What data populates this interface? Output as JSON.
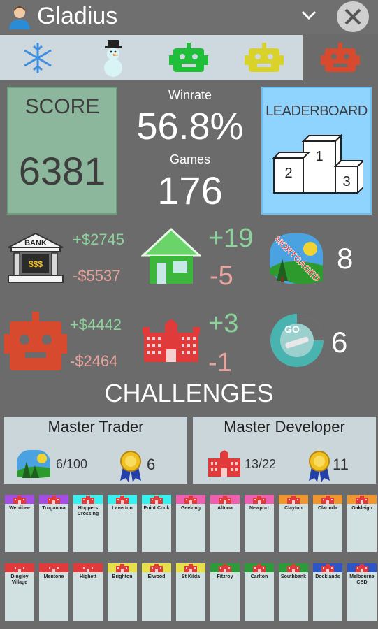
{
  "header": {
    "player_name": "Gladius"
  },
  "tabs": [
    {
      "icon": "snowflake-icon"
    },
    {
      "icon": "snowman-icon"
    },
    {
      "icon": "green-robot-icon"
    },
    {
      "icon": "yellow-robot-icon"
    },
    {
      "icon": "red-robot-icon",
      "active": true
    }
  ],
  "score": {
    "label": "SCORE",
    "value": "6381"
  },
  "winrate": {
    "label": "Winrate",
    "value": "56.8%"
  },
  "games": {
    "label": "Games",
    "value": "176"
  },
  "leaderboard": {
    "label": "LEADERBOARD",
    "places": [
      "1",
      "2",
      "3"
    ]
  },
  "bank": {
    "label": "BANK",
    "sign": "$$$",
    "plus": "+$2745",
    "minus": "-$5537"
  },
  "houses": {
    "plus": "+19",
    "minus": "-5"
  },
  "mortgaged": {
    "stamp": "MORTGAGED",
    "count": "8"
  },
  "robot": {
    "plus": "+$4442",
    "minus": "-$2464"
  },
  "hotels": {
    "plus": "+3",
    "minus": "-1"
  },
  "go": {
    "label": "GO",
    "count": "6"
  },
  "challenges_title": "CHALLENGES",
  "challenges": [
    {
      "title": "Master Trader",
      "progress": "6/100",
      "medals": "6"
    },
    {
      "title": "Master Developer",
      "progress": "13/22",
      "medals": "11"
    }
  ],
  "properties_row1": [
    {
      "name": "Werribee",
      "color": "#a44ee6"
    },
    {
      "name": "Truganina",
      "color": "#a44ee6"
    },
    {
      "name": "Hoppers Crossing",
      "color": "#37f0f0"
    },
    {
      "name": "Laverton",
      "color": "#37f0f0"
    },
    {
      "name": "Point Cook",
      "color": "#37f0f0"
    },
    {
      "name": "Geelong",
      "color": "#ee5fb0"
    },
    {
      "name": "Altona",
      "color": "#ee5fb0"
    },
    {
      "name": "Newport",
      "color": "#ee5fb0"
    },
    {
      "name": "Clayton",
      "color": "#f0962f"
    },
    {
      "name": "Clarinda",
      "color": "#f0962f"
    },
    {
      "name": "Oakleigh",
      "color": "#f0962f"
    }
  ],
  "properties_row2": [
    {
      "name": "Dingley Village",
      "color": "#e03a3a"
    },
    {
      "name": "Mentone",
      "color": "#e03a3a"
    },
    {
      "name": "Highett",
      "color": "#e03a3a"
    },
    {
      "name": "Brighton",
      "color": "#e6e04a"
    },
    {
      "name": "Elwood",
      "color": "#e6e04a"
    },
    {
      "name": "St Kilda",
      "color": "#e6e04a"
    },
    {
      "name": "Fitzroy",
      "color": "#2c9b3a"
    },
    {
      "name": "Carlton",
      "color": "#2c9b3a"
    },
    {
      "name": "Southbank",
      "color": "#2c9b3a"
    },
    {
      "name": "Docklands",
      "color": "#2d55c8"
    },
    {
      "name": "Melbourne CBD",
      "color": "#2d55c8"
    }
  ]
}
